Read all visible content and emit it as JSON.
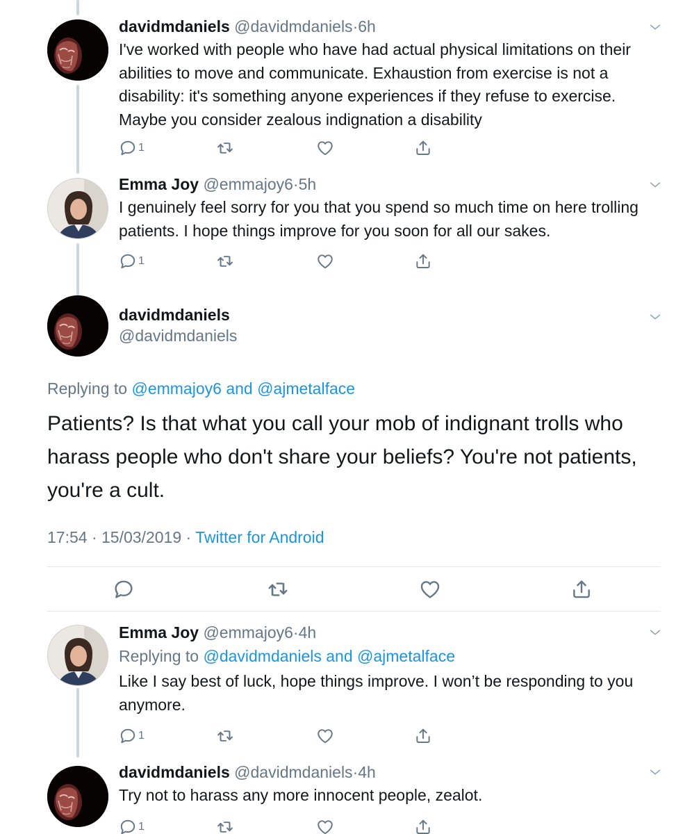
{
  "tweets": [
    {
      "name": "davidmdaniels",
      "handle": "@davidmdaniels",
      "sep": "·",
      "time": "6h",
      "text": "I've worked with people who have had actual physical limitations on their abilities to move and communicate. Exhaustion from exercise is not a disability: it's something anyone experiences if they refuse to exercise. Maybe you consider zealous indignation a disability",
      "reply_count": "1",
      "avatar": "masked-face-avatar"
    },
    {
      "name": "Emma Joy",
      "handle": "@emmajoy6",
      "sep": "·",
      "time": "5h",
      "text": "I genuinely feel sorry for you that you spend so much time on here trolling patients. I hope things improve for you soon for all our sakes.",
      "reply_count": "1",
      "avatar": "woman-portrait-avatar"
    },
    {
      "name": "Emma Joy",
      "handle": "@emmajoy6",
      "sep": "·",
      "time": "4h",
      "replying_prefix": "Replying to",
      "replying_user1": "@davidmdaniels",
      "replying_and": "and",
      "replying_user2": "@ajmetalface",
      "text": "Like I say best of luck, hope things improve. I won’t be responding to you anymore.",
      "reply_count": "1",
      "avatar": "woman-portrait-avatar"
    },
    {
      "name": "davidmdaniels",
      "handle": "@davidmdaniels",
      "sep": "·",
      "time": "4h",
      "text": "Try not to harass any more innocent people, zealot.",
      "reply_count": "1",
      "avatar": "masked-face-avatar"
    }
  ],
  "focused": {
    "name": "davidmdaniels",
    "handle": "@davidmdaniels",
    "replying_prefix": "Replying to",
    "replying_user1": "@emmajoy6",
    "replying_and": "and",
    "replying_user2": "@ajmetalface",
    "text": "Patients? Is that what you call your mob of indignant trolls who harass people who don't share your beliefs? You're not patients, you're a cult.",
    "datetime": "17:54 · 15/03/2019 · ",
    "source": "Twitter for Android"
  },
  "colors": {
    "link": "#1b95e0",
    "secondary": "#657786",
    "thread_line": "#ccd6dd",
    "divider": "#e1e8ed"
  },
  "icons": [
    "reply-icon",
    "retweet-icon",
    "like-icon",
    "share-icon",
    "chevron-down-icon"
  ]
}
